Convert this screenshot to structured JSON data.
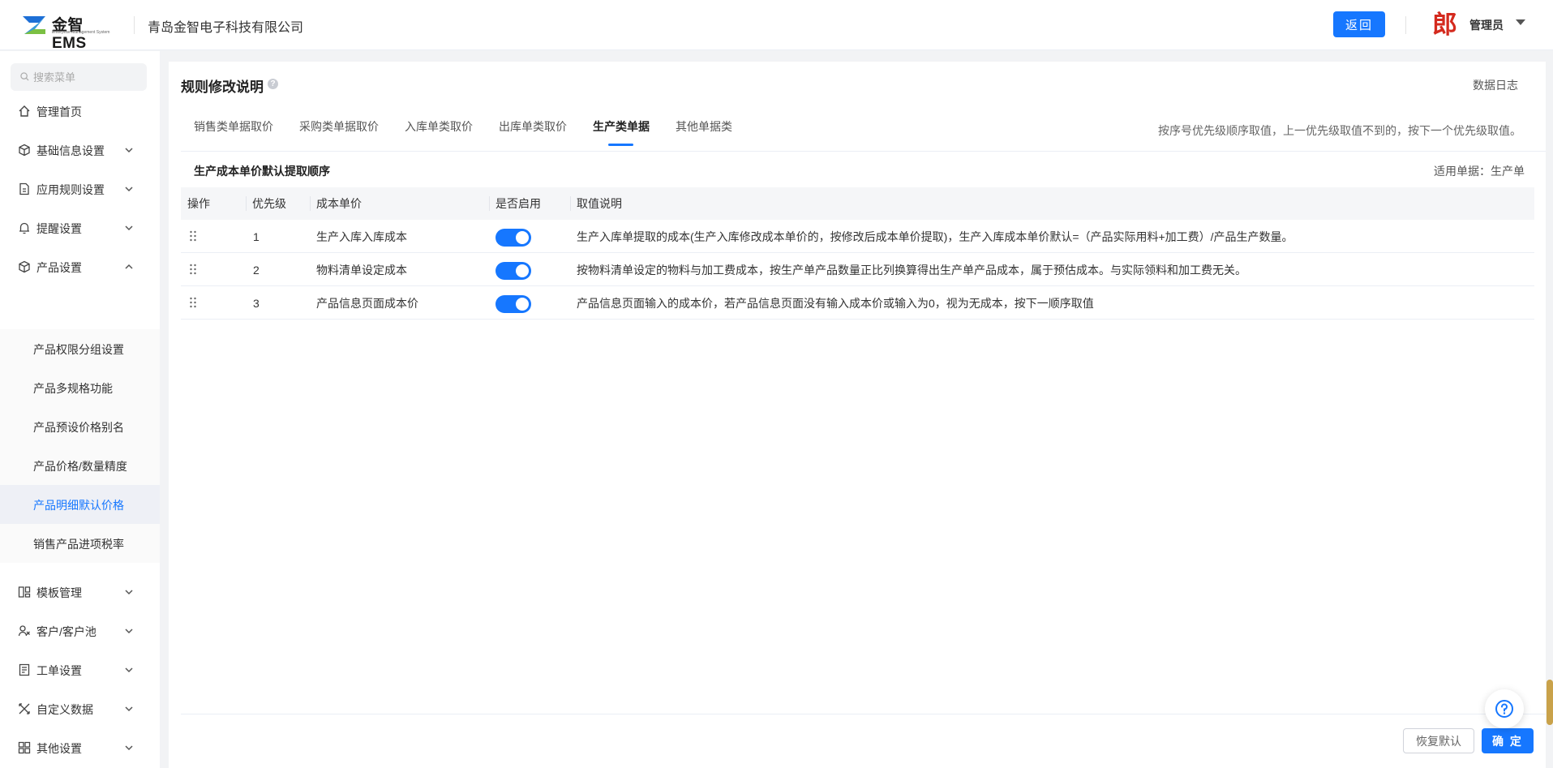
{
  "header": {
    "logo_text": "金智 EMS",
    "logo_sub": "Enterprise Management System",
    "company": "青岛金智电子科技有限公司",
    "back_label": "返回",
    "user_name": "管理员"
  },
  "sidebar": {
    "search_placeholder": "搜索菜单",
    "items": [
      {
        "label": "管理首页",
        "icon": "home-icon"
      },
      {
        "label": "基础信息设置",
        "icon": "cube-icon"
      },
      {
        "label": "应用规则设置",
        "icon": "document-icon"
      },
      {
        "label": "提醒设置",
        "icon": "bell-icon"
      },
      {
        "label": "产品设置",
        "icon": "cube-icon"
      },
      {
        "label": "模板管理",
        "icon": "template-icon"
      },
      {
        "label": "客户/客户池",
        "icon": "customer-icon"
      },
      {
        "label": "工单设置",
        "icon": "ticket-icon"
      },
      {
        "label": "自定义数据",
        "icon": "tools-icon"
      },
      {
        "label": "其他设置",
        "icon": "grid-icon"
      }
    ],
    "sub_items": [
      {
        "label": "产品权限分组设置"
      },
      {
        "label": "产品多规格功能"
      },
      {
        "label": "产品预设价格别名"
      },
      {
        "label": "产品价格/数量精度"
      },
      {
        "label": "产品明细默认价格",
        "active": true
      },
      {
        "label": "销售产品进项税率"
      }
    ]
  },
  "main": {
    "title": "规则修改说明",
    "data_log": "数据日志",
    "tabs": [
      {
        "label": "销售类单据取价"
      },
      {
        "label": "采购类单据取价"
      },
      {
        "label": "入库单类取价"
      },
      {
        "label": "出库单类取价"
      },
      {
        "label": "生产类单据",
        "active": true
      },
      {
        "label": "其他单据类"
      }
    ],
    "tab_note": "按序号优先级顺序取值，上一优先级取值不到的，按下一个优先级取值。",
    "section_title": "生产成本单价默认提取顺序",
    "applies_to": "适用单据：生产单",
    "table": {
      "columns": [
        "操作",
        "优先级",
        "成本单价",
        "是否启用",
        "取值说明"
      ],
      "rows": [
        {
          "priority": "1",
          "name": "生产入库入库成本",
          "enabled": true,
          "desc": "生产入库单提取的成本(生产入库修改成本单价的，按修改后成本单价提取)，生产入库成本单价默认=（产品实际用料+加工费）/产品生产数量。"
        },
        {
          "priority": "2",
          "name": "物料清单设定成本",
          "enabled": true,
          "desc": "按物料清单设定的物料与加工费成本，按生产单产品数量正比列换算得出生产单产品成本，属于预估成本。与实际领料和加工费无关。"
        },
        {
          "priority": "3",
          "name": "产品信息页面成本价",
          "enabled": true,
          "desc": "产品信息页面输入的成本价，若产品信息页面没有输入成本价或输入为0，视为无成本，按下一顺序取值"
        }
      ]
    },
    "restore_label": "恢复默认",
    "confirm_label": "确 定"
  },
  "colors": {
    "accent": "#1677ff",
    "user_logo": "#d42a1e"
  }
}
